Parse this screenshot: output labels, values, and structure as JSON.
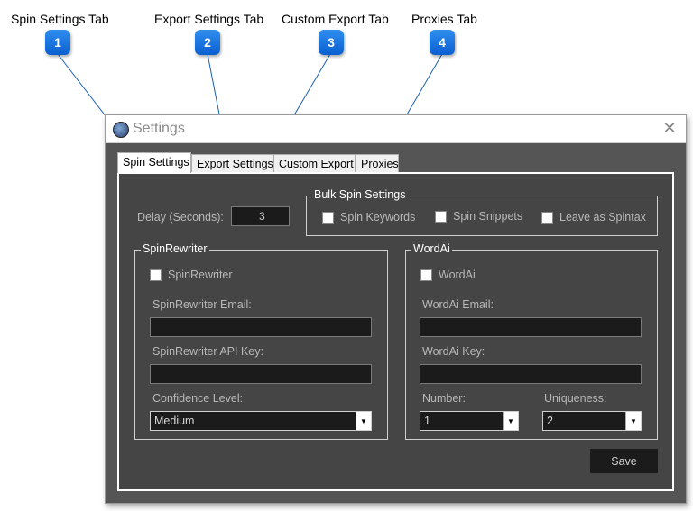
{
  "callouts": [
    {
      "number": "1",
      "label": "Spin Settings Tab"
    },
    {
      "number": "2",
      "label": "Export Settings Tab"
    },
    {
      "number": "3",
      "label": "Custom Export Tab"
    },
    {
      "number": "4",
      "label": "Proxies Tab"
    }
  ],
  "window": {
    "title": "Settings",
    "close_icon": "close-icon",
    "app_icon": "app-icon"
  },
  "tabs": [
    {
      "label": "Spin Settings",
      "active": true
    },
    {
      "label": "Export Settings",
      "active": false
    },
    {
      "label": "Custom Export",
      "active": false
    },
    {
      "label": "Proxies",
      "active": false
    }
  ],
  "spin_settings": {
    "delay_label": "Delay (Seconds):",
    "delay_value": "3",
    "bulk": {
      "title": "Bulk Spin Settings",
      "options": [
        "Spin Keywords",
        "Spin Snippets",
        "Leave as Spintax"
      ]
    },
    "spinrewriter": {
      "title": "SpinRewriter",
      "checkbox_label": "SpinRewriter",
      "email_label": "SpinRewriter Email:",
      "email_value": "",
      "api_key_label": "SpinRewriter API Key:",
      "api_key_value": "",
      "confidence_label": "Confidence Level:",
      "confidence_value": "Medium"
    },
    "wordai": {
      "title": "WordAi",
      "checkbox_label": "WordAi",
      "email_label": "WordAi Email:",
      "email_value": "",
      "key_label": "WordAi Key:",
      "key_value": "",
      "number_label": "Number:",
      "number_value": "1",
      "uniqueness_label": "Uniqueness:",
      "uniqueness_value": "2"
    },
    "save_label": "Save"
  },
  "colors": {
    "badge": "#1a73e8",
    "window_bg": "#555555",
    "panel_bg": "#454545",
    "field_bg": "#1b1b1b"
  }
}
